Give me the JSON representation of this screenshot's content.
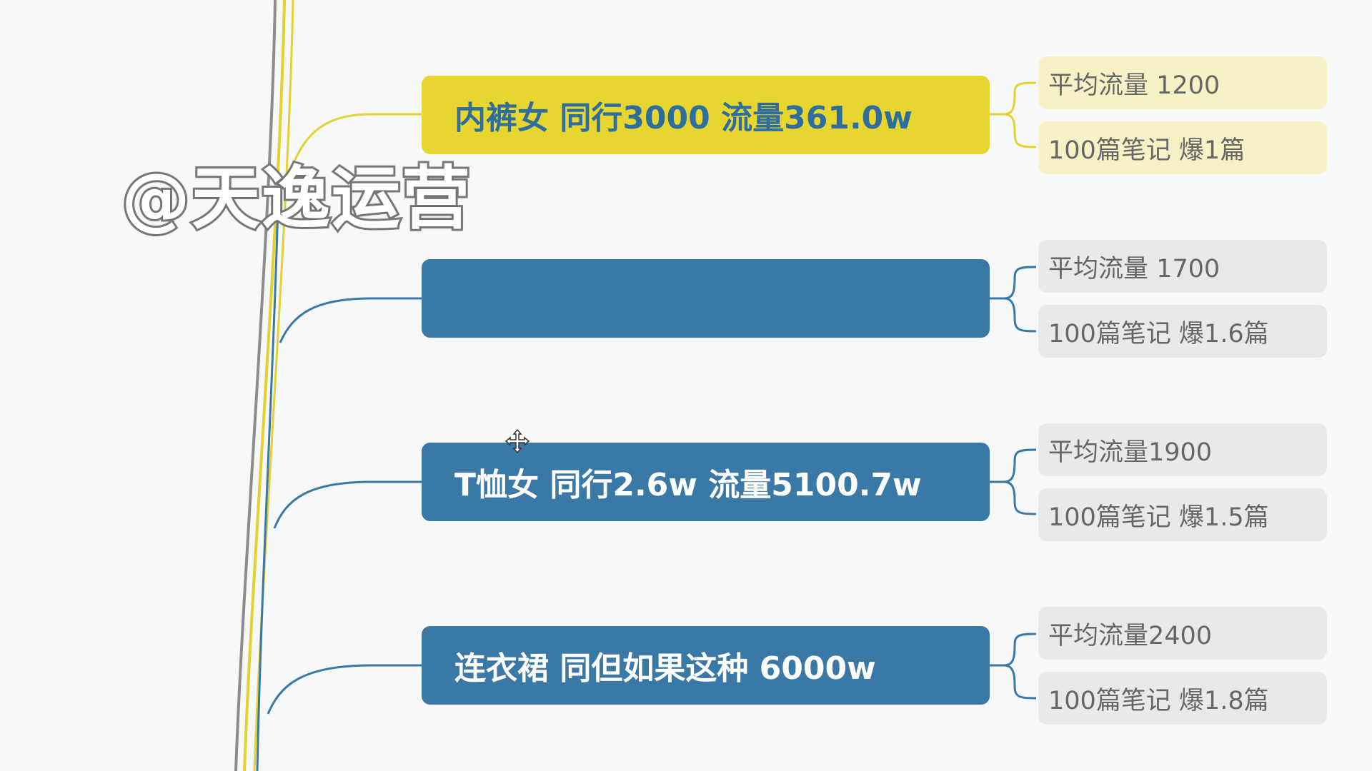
{
  "colors": {
    "yellow_topic": "#e7d62f",
    "yellow_topic_text": "#2e6e9e",
    "blue_topic": "#3a79a6",
    "blue_topic_text": "#ffffff",
    "yellow_sub_bg": "#f7f1c6",
    "gray_sub_bg": "#e9e9eb",
    "yellow_line": "#e3d22f",
    "blue_line": "#3a79a6",
    "trunk_gray": "#8d8d8d",
    "background": "#f6f8fa"
  },
  "watermark": {
    "text": "@天逸运营"
  },
  "topics": [
    {
      "label": "内裤女 同行3000 流量361.0w",
      "style": "yellow",
      "children": [
        {
          "label": "平均流量 1200"
        },
        {
          "label": "100篇笔记 爆1篇"
        }
      ]
    },
    {
      "label": "",
      "style": "blue",
      "children": [
        {
          "label": "平均流量 1700"
        },
        {
          "label": "100篇笔记 爆1.6篇"
        }
      ]
    },
    {
      "label": "T恤女 同行2.6w 流量5100.7w",
      "style": "blue",
      "children": [
        {
          "label": "平均流量1900"
        },
        {
          "label": "100篇笔记 爆1.5篇"
        }
      ]
    },
    {
      "label": "连衣裙 同但如果这种 6000w",
      "style": "blue",
      "children": [
        {
          "label": "平均流量2400"
        },
        {
          "label": "100篇笔记 爆1.8篇"
        }
      ]
    }
  ],
  "cursor_icon": "move-cursor-icon"
}
